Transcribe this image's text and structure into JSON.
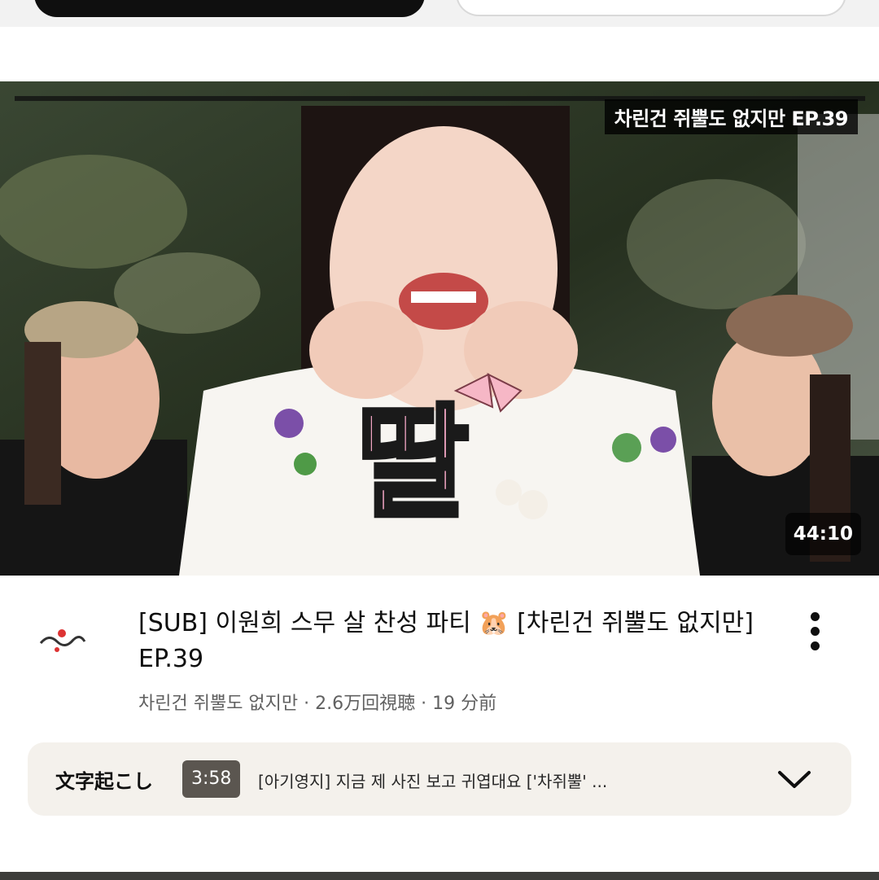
{
  "video": {
    "overlay_title": "차린건 쥐뿔도 없지만 EP.39",
    "sticker_text": "딸",
    "duration": "44:10",
    "title": "[SUB] 이원희 스무 살 찬성 파티 🐹   [차린건 쥐뿔도 없지만] EP.39",
    "channel": "차린건 쥐뿔도 없지만",
    "views": "2.6万回視聴",
    "age": "19 分前",
    "separator": "·"
  },
  "transcript": {
    "label": "文字起こし",
    "timestamp": "3:58",
    "preview": "[아기영지] 지금 제 사진 보고 귀엽대요 ['차쥐뿔' ..."
  },
  "icons": {
    "menu": "kebab-menu-icon",
    "expand": "chevron-down-icon",
    "avatar": "channel-avatar"
  }
}
